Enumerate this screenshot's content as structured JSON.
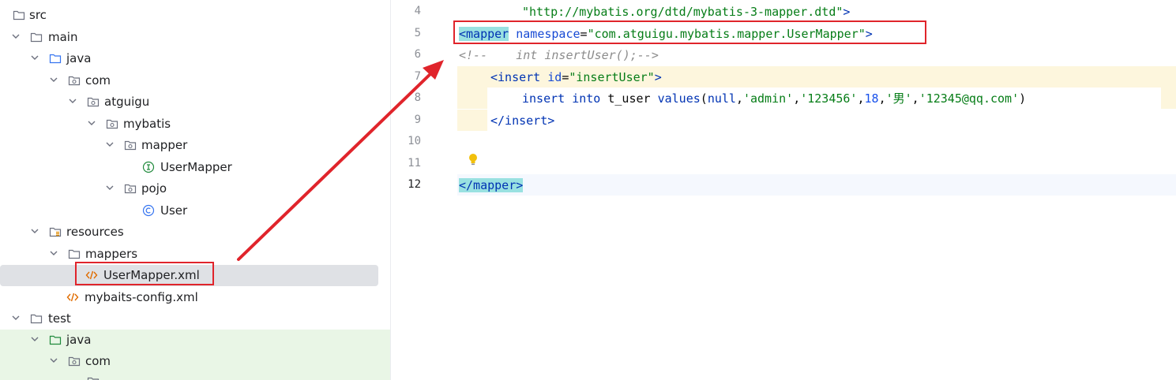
{
  "tree": {
    "items": [
      {
        "label": "src"
      },
      {
        "label": "main"
      },
      {
        "label": "java"
      },
      {
        "label": "com"
      },
      {
        "label": "atguigu"
      },
      {
        "label": "mybatis"
      },
      {
        "label": "mapper"
      },
      {
        "label": "UserMapper"
      },
      {
        "label": "pojo"
      },
      {
        "label": "User"
      },
      {
        "label": "resources"
      },
      {
        "label": "mappers"
      },
      {
        "label": "UserMapper.xml"
      },
      {
        "label": "mybaits-config.xml"
      },
      {
        "label": "test"
      },
      {
        "label": "java"
      },
      {
        "label": "com"
      }
    ],
    "selected_color": "#dfe1e5",
    "test_bg_color": "#e9f6e6"
  },
  "editor": {
    "line_numbers": [
      "4",
      "5",
      "6",
      "7",
      "8",
      "9",
      "10",
      "11",
      "12"
    ],
    "current_line": "12",
    "line4": {
      "str": "\"http://mybatis.org/dtd/mybatis-3-mapper.dtd\"",
      "close": ">"
    },
    "line5": {
      "open": "<mapper",
      "attr": "namespace",
      "eq": "=",
      "str": "\"com.atguigu.mybatis.mapper.UserMapper\"",
      "close": ">"
    },
    "line6": {
      "comment": "<!--    int insertUser();-->"
    },
    "line7": {
      "open": "<insert",
      "attr": "id",
      "eq": "=",
      "str": "\"insertUser\"",
      "close": ">"
    },
    "line8": {
      "kw1": "insert",
      "kw2": "into",
      "table": "t_user",
      "kw3": "values",
      "p_open": "(",
      "null": "null",
      "c1": ",",
      "s1": "'admin'",
      "c2": ",",
      "s2": "'123456'",
      "c3": ",",
      "n": "18",
      "c4": ",",
      "s3": "'男'",
      "c5": ",",
      "s4": "'12345@qq.com'",
      "p_close": ")"
    },
    "line9": {
      "close_tag": "</insert>"
    },
    "line12": {
      "open": "</mapper",
      "close": ">"
    },
    "highlight_color": "#fdf6dd",
    "current_line_color": "#f5f8fe"
  },
  "annotation": {
    "color": "#e0242b"
  }
}
